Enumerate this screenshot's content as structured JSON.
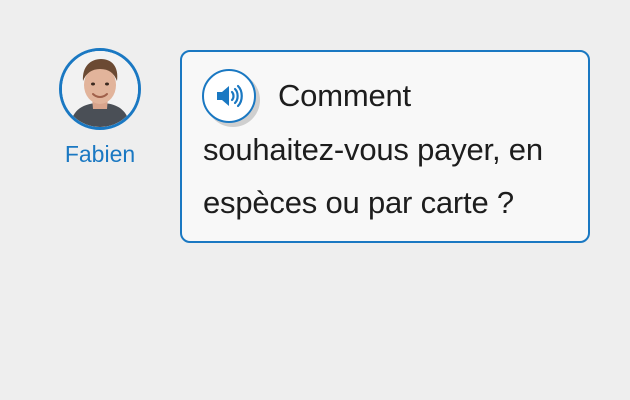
{
  "speaker": {
    "name": "Fabien"
  },
  "message": {
    "lines": [
      "Comment",
      "souhaitez-vous payer, en",
      "espèces ou par carte ?"
    ]
  },
  "colors": {
    "accent": "#1a78c2",
    "background": "#eeeeee",
    "bubble_background": "#f8f8f8",
    "text": "#1d1d1d"
  },
  "icons": {
    "audio": "speaker-volume-icon"
  }
}
